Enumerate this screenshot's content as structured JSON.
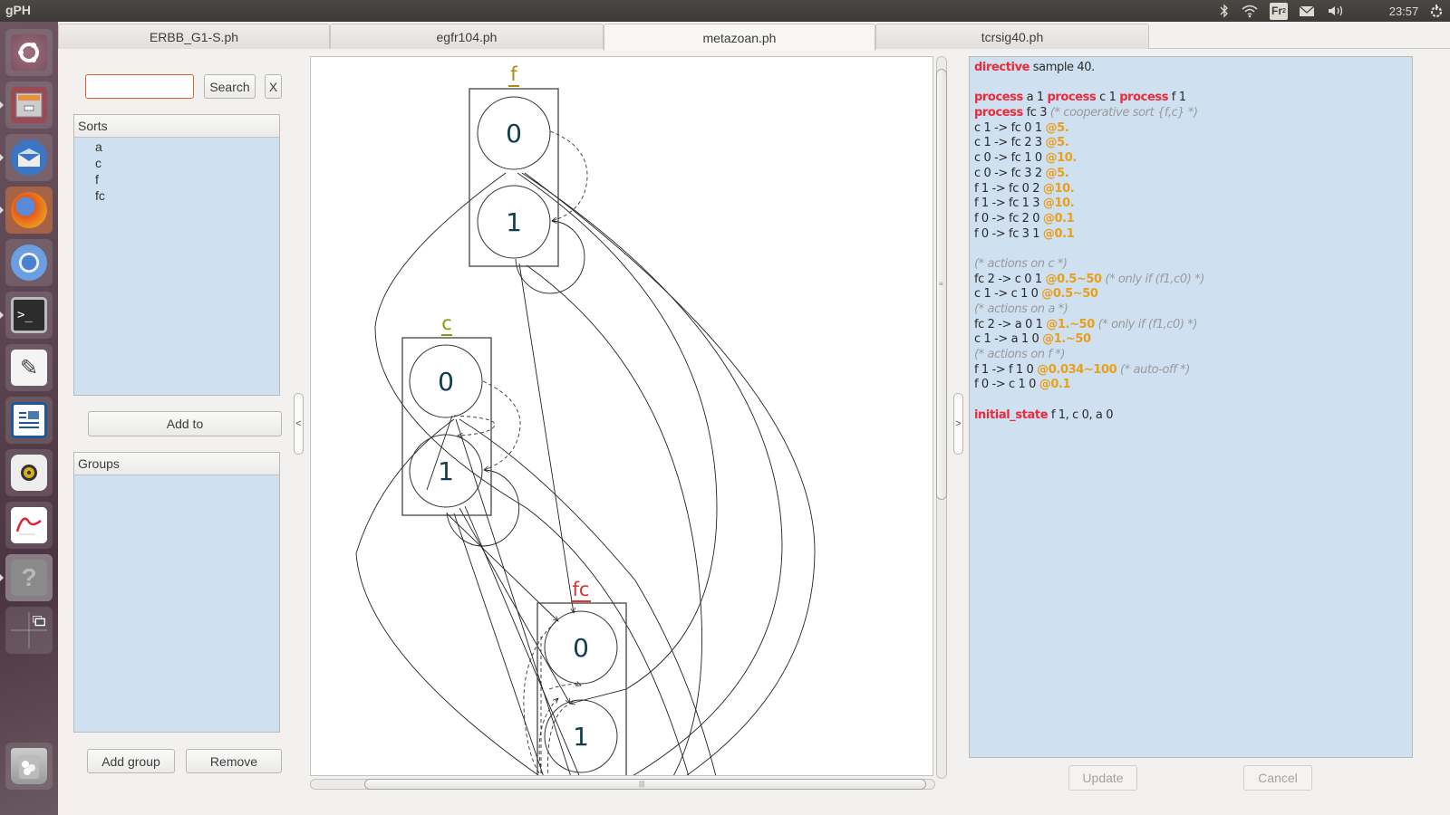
{
  "top_panel": {
    "app_title": "gPH",
    "keyboard_layout": "Fr",
    "keyboard_layout_sub": "2",
    "clock": "23:57",
    "icons": [
      "bluetooth-icon",
      "wifi-icon",
      "keyboard-layout-icon",
      "mail-icon",
      "volume-icon",
      "power-gear-icon"
    ]
  },
  "launcher": {
    "items": [
      {
        "name": "ubuntu-dash",
        "icon": "ubuntu-logo-icon",
        "color": "#8a5a6a"
      },
      {
        "name": "files",
        "icon": "file-cabinet-icon",
        "color": "#9a4a55"
      },
      {
        "name": "thunderbird",
        "icon": "thunderbird-icon",
        "color": "#3a76c4"
      },
      {
        "name": "firefox",
        "icon": "firefox-icon",
        "color": "#d46a2a"
      },
      {
        "name": "chromium",
        "icon": "chromium-icon",
        "color": "#6a5a66"
      },
      {
        "name": "terminal",
        "icon": "terminal-icon",
        "color": "#7a7a7a"
      },
      {
        "name": "text-editor",
        "icon": "text-editor-icon",
        "color": "#7a6a72"
      },
      {
        "name": "libreoffice-writer",
        "icon": "writer-icon",
        "color": "#3a6aa4"
      },
      {
        "name": "rhythmbox",
        "icon": "speaker-icon",
        "color": "#7a6a72"
      },
      {
        "name": "document-viewer",
        "icon": "pdf-viewer-icon",
        "color": "#7a6a72"
      },
      {
        "name": "help",
        "icon": "question-icon",
        "color": "#8a8a8a"
      },
      {
        "name": "workspace-switcher",
        "icon": "workspaces-icon",
        "color": "#6a5a66"
      },
      {
        "name": "trash",
        "icon": "trash-icon",
        "color": "#6a5a66"
      }
    ]
  },
  "tabs": [
    {
      "label": "ERBB_G1-S.ph",
      "active": false
    },
    {
      "label": "egfr104.ph",
      "active": false
    },
    {
      "label": "metazoan.ph",
      "active": true
    },
    {
      "label": "tcrsig40.ph",
      "active": false
    }
  ],
  "left_panel": {
    "search": {
      "value": "",
      "button": "Search",
      "clear_button": "X"
    },
    "sorts": {
      "header": "Sorts",
      "items": [
        "a",
        "c",
        "f",
        "fc"
      ]
    },
    "add_to_button": "Add to",
    "groups": {
      "header": "Groups",
      "items": []
    },
    "add_group_button": "Add group",
    "remove_button": "Remove",
    "collapse_handle": "<"
  },
  "graph": {
    "sorts": [
      {
        "name": "f",
        "color": "#b8860b",
        "processes": [
          "0",
          "1"
        ]
      },
      {
        "name": "c",
        "color": "#8a9a10",
        "processes": [
          "0",
          "1"
        ]
      },
      {
        "name": "fc",
        "color": "#e03030",
        "processes": [
          "0",
          "1"
        ]
      }
    ]
  },
  "right_panel": {
    "collapse_handle": ">",
    "code_lines": [
      [
        {
          "t": "kw",
          "v": "directive"
        },
        {
          "t": "n",
          "v": " sample 40."
        }
      ],
      [],
      [
        {
          "t": "kw",
          "v": "process"
        },
        {
          "t": "n",
          "v": " a 1 "
        },
        {
          "t": "kw",
          "v": "process"
        },
        {
          "t": "n",
          "v": " c 1 "
        },
        {
          "t": "kw",
          "v": "process"
        },
        {
          "t": "n",
          "v": " f 1"
        }
      ],
      [
        {
          "t": "kw",
          "v": "process"
        },
        {
          "t": "n",
          "v": " fc 3 "
        },
        {
          "t": "cm",
          "v": "(* cooperative sort {f,c} *)"
        }
      ],
      [
        {
          "t": "n",
          "v": "c 1 -> fc 0 1 "
        },
        {
          "t": "rate",
          "v": "@5."
        }
      ],
      [
        {
          "t": "n",
          "v": "c 1 -> fc 2 3 "
        },
        {
          "t": "rate",
          "v": "@5."
        }
      ],
      [
        {
          "t": "n",
          "v": "c 0 -> fc 1 0 "
        },
        {
          "t": "rate",
          "v": "@10."
        }
      ],
      [
        {
          "t": "n",
          "v": "c 0 -> fc 3 2 "
        },
        {
          "t": "rate",
          "v": "@5."
        }
      ],
      [
        {
          "t": "n",
          "v": "f 1 -> fc 0 2 "
        },
        {
          "t": "rate",
          "v": "@10."
        }
      ],
      [
        {
          "t": "n",
          "v": "f 1 -> fc 1 3 "
        },
        {
          "t": "rate",
          "v": "@10."
        }
      ],
      [
        {
          "t": "n",
          "v": "f 0 -> fc 2 0 "
        },
        {
          "t": "rate",
          "v": "@0.1"
        }
      ],
      [
        {
          "t": "n",
          "v": "f 0 -> fc 3 1 "
        },
        {
          "t": "rate",
          "v": "@0.1"
        }
      ],
      [],
      [
        {
          "t": "cm",
          "v": "(* actions on c *)"
        }
      ],
      [
        {
          "t": "n",
          "v": "fc 2 -> c 0 1 "
        },
        {
          "t": "rate",
          "v": "@0.5~50"
        },
        {
          "t": "n",
          "v": " "
        },
        {
          "t": "cm",
          "v": "(* only if (f1,c0) *)"
        }
      ],
      [
        {
          "t": "n",
          "v": "c 1 -> c 1 0 "
        },
        {
          "t": "rate",
          "v": "@0.5~50"
        }
      ],
      [
        {
          "t": "cm",
          "v": "(* actions on a *)"
        }
      ],
      [
        {
          "t": "n",
          "v": "fc 2 -> a 0 1 "
        },
        {
          "t": "rate",
          "v": "@1.~50"
        },
        {
          "t": "n",
          "v": " "
        },
        {
          "t": "cm",
          "v": "(* only if (f1,c0) *)"
        }
      ],
      [
        {
          "t": "n",
          "v": "c 1 -> a 1 0 "
        },
        {
          "t": "rate",
          "v": "@1.~50"
        }
      ],
      [
        {
          "t": "cm",
          "v": "(* actions on f *)"
        }
      ],
      [
        {
          "t": "n",
          "v": "f 1 -> f 1 0 "
        },
        {
          "t": "rate",
          "v": "@0.034~100"
        },
        {
          "t": "n",
          "v": " "
        },
        {
          "t": "cm",
          "v": "(* auto-off *)"
        }
      ],
      [
        {
          "t": "n",
          "v": "f 0 -> c 1 0 "
        },
        {
          "t": "rate",
          "v": "@0.1"
        }
      ],
      [],
      [
        {
          "t": "kw",
          "v": "initial_state"
        },
        {
          "t": "n",
          "v": " f 1, c 0, a 0"
        }
      ]
    ],
    "update_button": "Update",
    "cancel_button": "Cancel"
  }
}
